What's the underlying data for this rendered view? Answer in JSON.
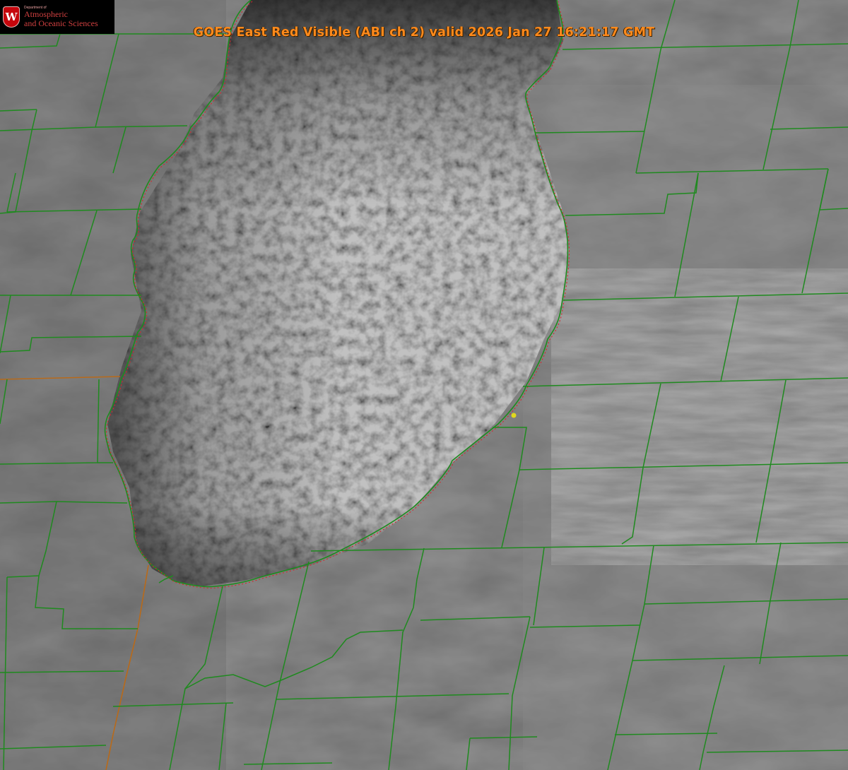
{
  "logo": {
    "letter": "W",
    "dept_small": "Department of",
    "line1": "Atmospheric",
    "line2": "and Oceanic Sciences"
  },
  "title": "GOES East Red Visible (ABI ch 2) valid 2026 Jan 27 16:21:17 GMT",
  "colors": {
    "title": "#ff8a1c",
    "county_borders": "#1f8a1f",
    "shoreline_dotted": "#d62828",
    "state_border": "#b86a1a",
    "marker": "#e0d81e"
  }
}
